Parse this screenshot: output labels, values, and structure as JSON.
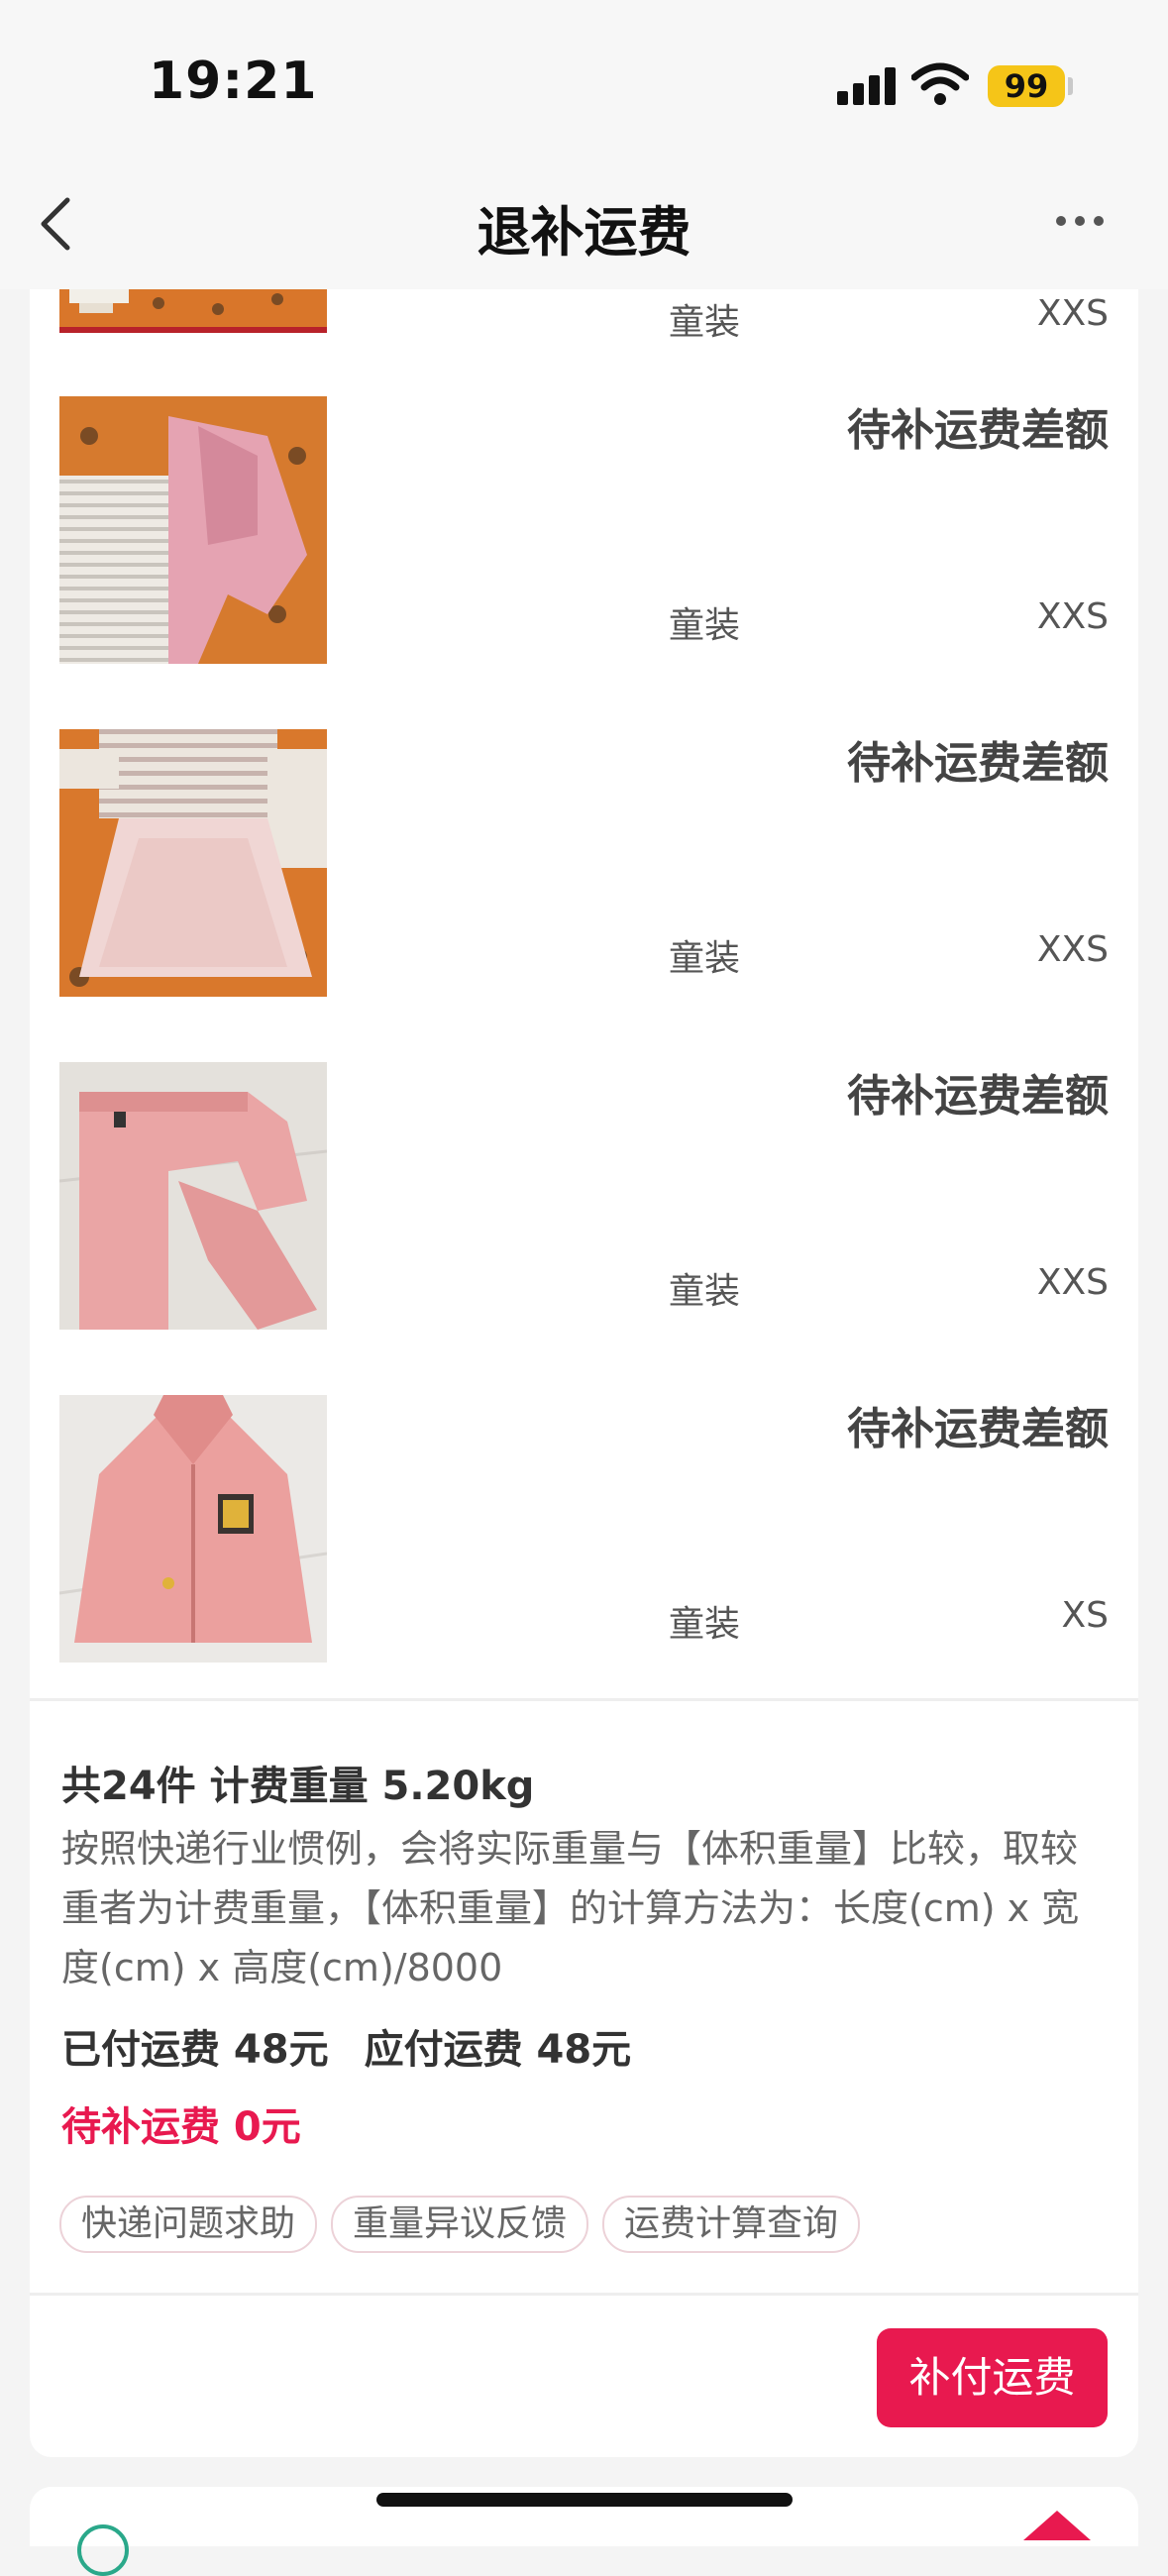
{
  "status_bar": {
    "time": "19:21",
    "battery": "99"
  },
  "nav": {
    "title": "退补运费"
  },
  "items": [
    {
      "status": "",
      "category": "童装",
      "size": "XXS"
    },
    {
      "status": "待补运费差额",
      "category": "童装",
      "size": "XXS"
    },
    {
      "status": "待补运费差额",
      "category": "童装",
      "size": "XXS"
    },
    {
      "status": "待补运费差额",
      "category": "童装",
      "size": "XXS"
    },
    {
      "status": "待补运费差额",
      "category": "童装",
      "size": "XS"
    }
  ],
  "summary": {
    "title": "共24件 计费重量 5.20kg",
    "description": "按照快递行业惯例，会将实际重量与【体积重量】比较，取较重者为计费重量，【体积重量】的计算方法为：长度(cm) x 宽度(cm) x 高度(cm)/8000",
    "paid": "已付运费 48元",
    "payable": "应付运费 48元",
    "pending": "待补运费 0元"
  },
  "tags": [
    "快递问题求助",
    "重量异议反馈",
    "运费计算查询"
  ],
  "pay_button": "补付运费",
  "colors": {
    "accent": "#e8194f",
    "battery": "#f5c518",
    "background": "#f4f4f4"
  }
}
